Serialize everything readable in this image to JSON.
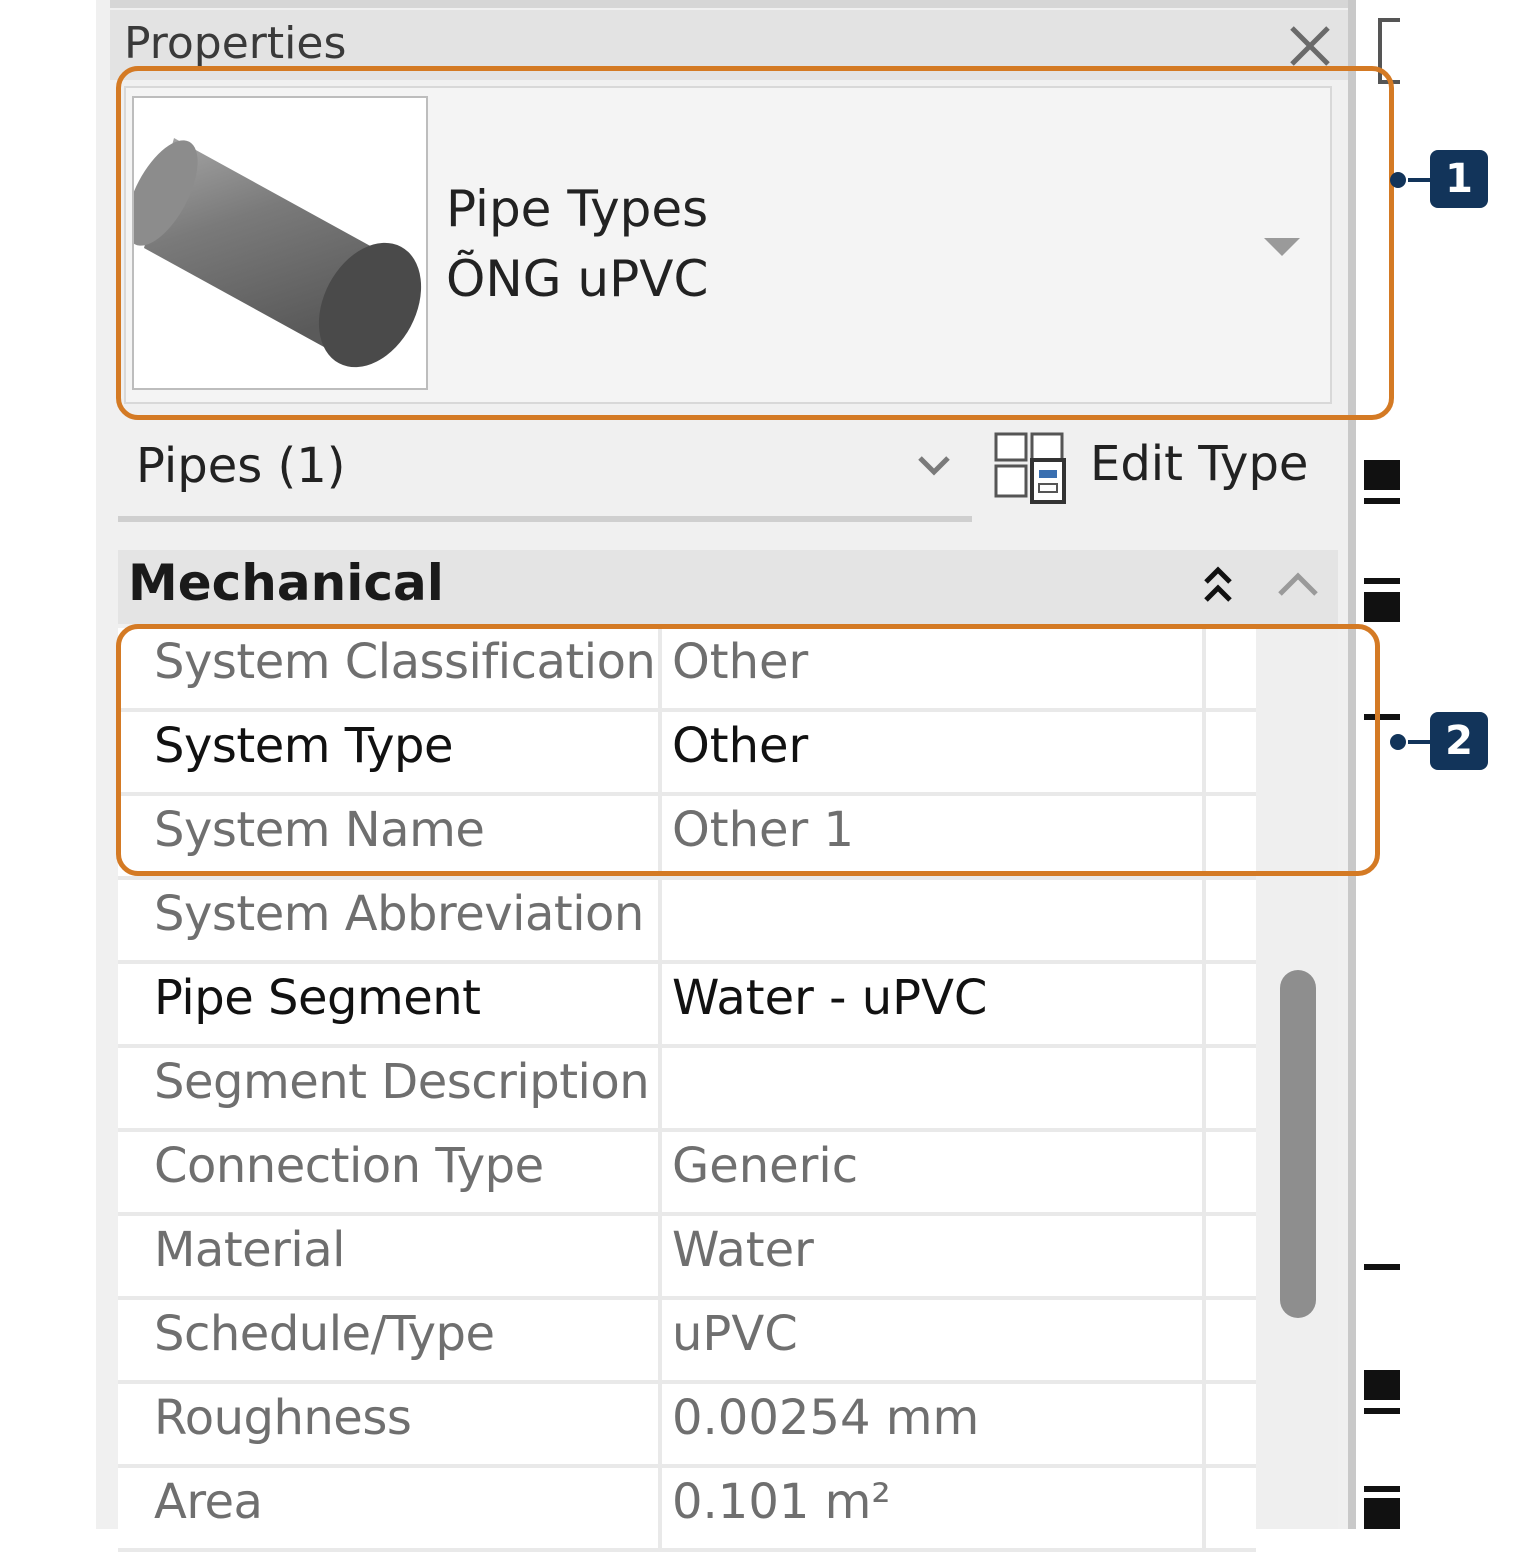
{
  "panel": {
    "title": "Properties",
    "type_selector": {
      "family": "Pipe Types",
      "type_name": "ÕNG uPVC"
    },
    "filter": {
      "selection_label": "Pipes (1)",
      "edit_type_label": "Edit Type"
    },
    "group": {
      "title": "Mechanical"
    },
    "properties": [
      {
        "name": "System Classification",
        "value": "Other",
        "editable": false
      },
      {
        "name": "System Type",
        "value": "Other",
        "editable": true
      },
      {
        "name": "System Name",
        "value": "Other 1",
        "editable": false
      },
      {
        "name": "System Abbreviation",
        "value": "",
        "editable": false
      },
      {
        "name": "Pipe Segment",
        "value": "Water - uPVC",
        "editable": true
      },
      {
        "name": "Segment Description",
        "value": "",
        "editable": false
      },
      {
        "name": "Connection Type",
        "value": "Generic",
        "editable": false
      },
      {
        "name": "Material",
        "value": "Water",
        "editable": false
      },
      {
        "name": "Schedule/Type",
        "value": "uPVC",
        "editable": false
      },
      {
        "name": "Roughness",
        "value": "0.00254 mm",
        "editable": false
      },
      {
        "name": "Area",
        "value": "0.101 m²",
        "editable": false
      }
    ]
  },
  "annotations": {
    "callout_1": "1",
    "callout_2": "2",
    "highlight_color": "#d47a24",
    "badge_color": "#12345a"
  },
  "icons": {
    "close": "close-icon",
    "dropdown": "dropdown-arrow-icon",
    "chevron": "chevron-down-icon",
    "edit_type": "edit-type-icon",
    "collapse_all": "double-chevron-up-icon",
    "collapse": "chevron-up-icon",
    "pipe_preview": "pipe-preview-icon"
  }
}
